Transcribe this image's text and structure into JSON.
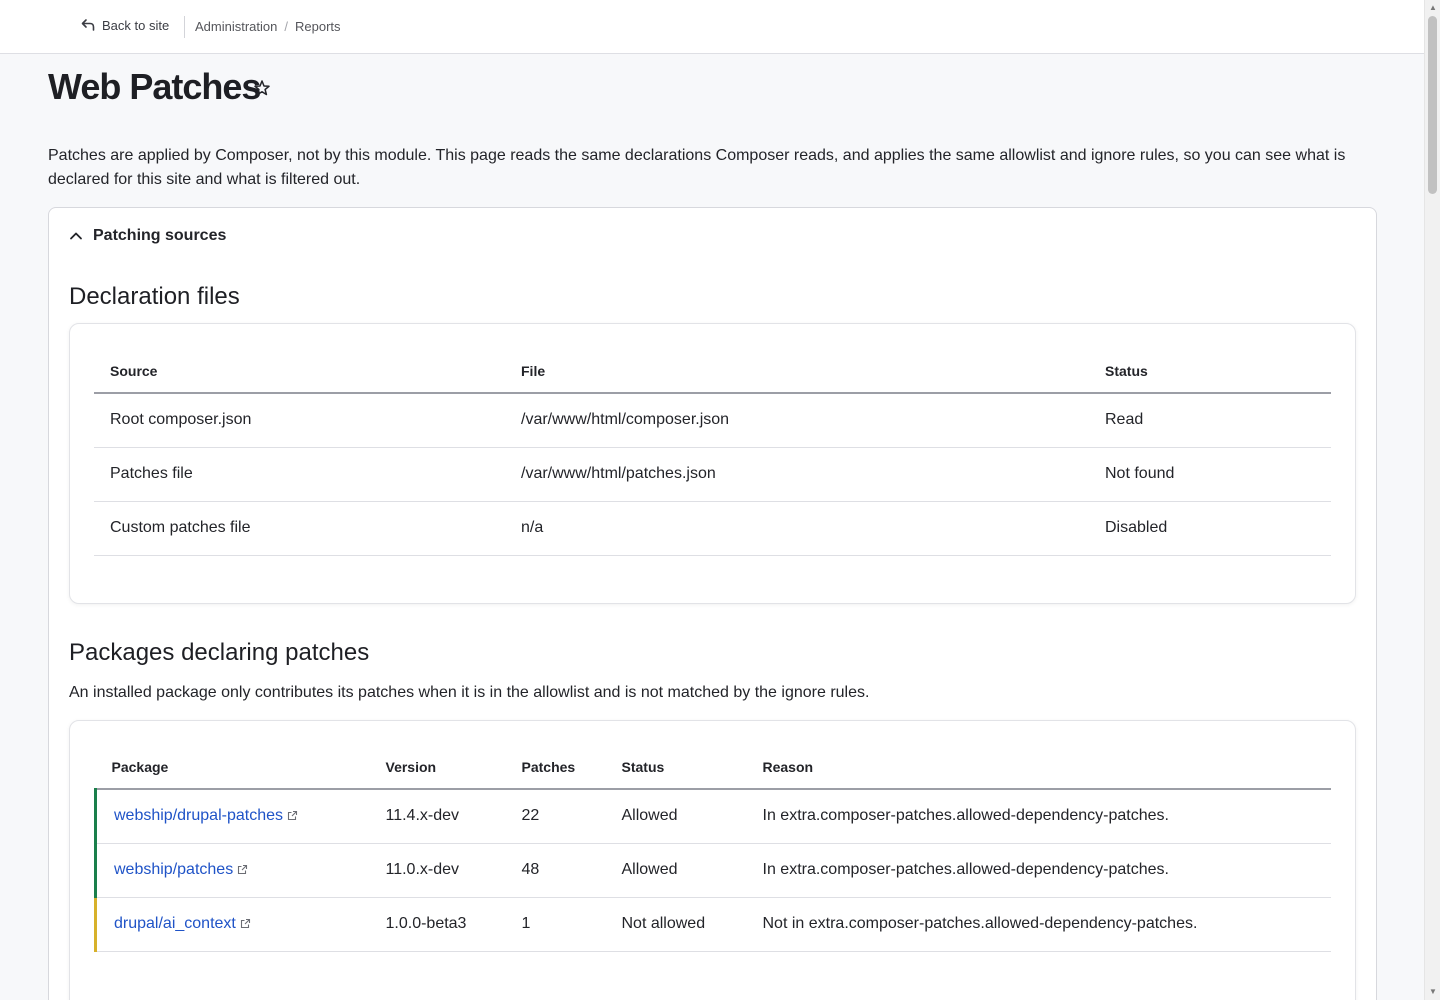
{
  "topbar": {
    "back_label": "Back to site",
    "breadcrumbs": [
      "Administration",
      "Reports"
    ]
  },
  "page": {
    "title": "Web Patches",
    "intro": "Patches are applied by Composer, not by this module. This page reads the same declarations Composer reads, and applies the same allowlist and ignore rules, so you can see what is declared for this site and what is filtered out."
  },
  "details": {
    "summary": "Patching sources",
    "declaration": {
      "heading": "Declaration files",
      "columns": [
        "Source",
        "File",
        "Status"
      ],
      "rows": [
        {
          "source": "Root composer.json",
          "file": "/var/www/html/composer.json",
          "status": "Read"
        },
        {
          "source": "Patches file",
          "file": "/var/www/html/patches.json",
          "status": "Not found"
        },
        {
          "source": "Custom patches file",
          "file": "n/a",
          "status": "Disabled"
        }
      ]
    },
    "packages": {
      "heading": "Packages declaring patches",
      "description": "An installed package only contributes its patches when it is in the allowlist and is not matched by the ignore rules.",
      "columns": [
        "Package",
        "Version",
        "Patches",
        "Status",
        "Reason"
      ],
      "rows": [
        {
          "package": "webship/drupal-patches",
          "version": "11.4.x-dev",
          "patches": "22",
          "status": "Allowed",
          "reason": "In extra.composer-patches.allowed-dependency-patches."
        },
        {
          "package": "webship/patches",
          "version": "11.0.x-dev",
          "patches": "48",
          "status": "Allowed",
          "reason": "In extra.composer-patches.allowed-dependency-patches."
        },
        {
          "package": "drupal/ai_context",
          "version": "1.0.0-beta3",
          "patches": "1",
          "status": "Not allowed",
          "reason": "Not in extra.composer-patches.allowed-dependency-patches."
        }
      ]
    }
  },
  "colors": {
    "allowed_marker": "#1a7f4b",
    "not_allowed_marker": "#d7b12a",
    "link": "#1f53c7"
  },
  "icons": [
    "back-arrow-icon",
    "star-icon",
    "chevron-up-icon",
    "external-link-icon"
  ]
}
